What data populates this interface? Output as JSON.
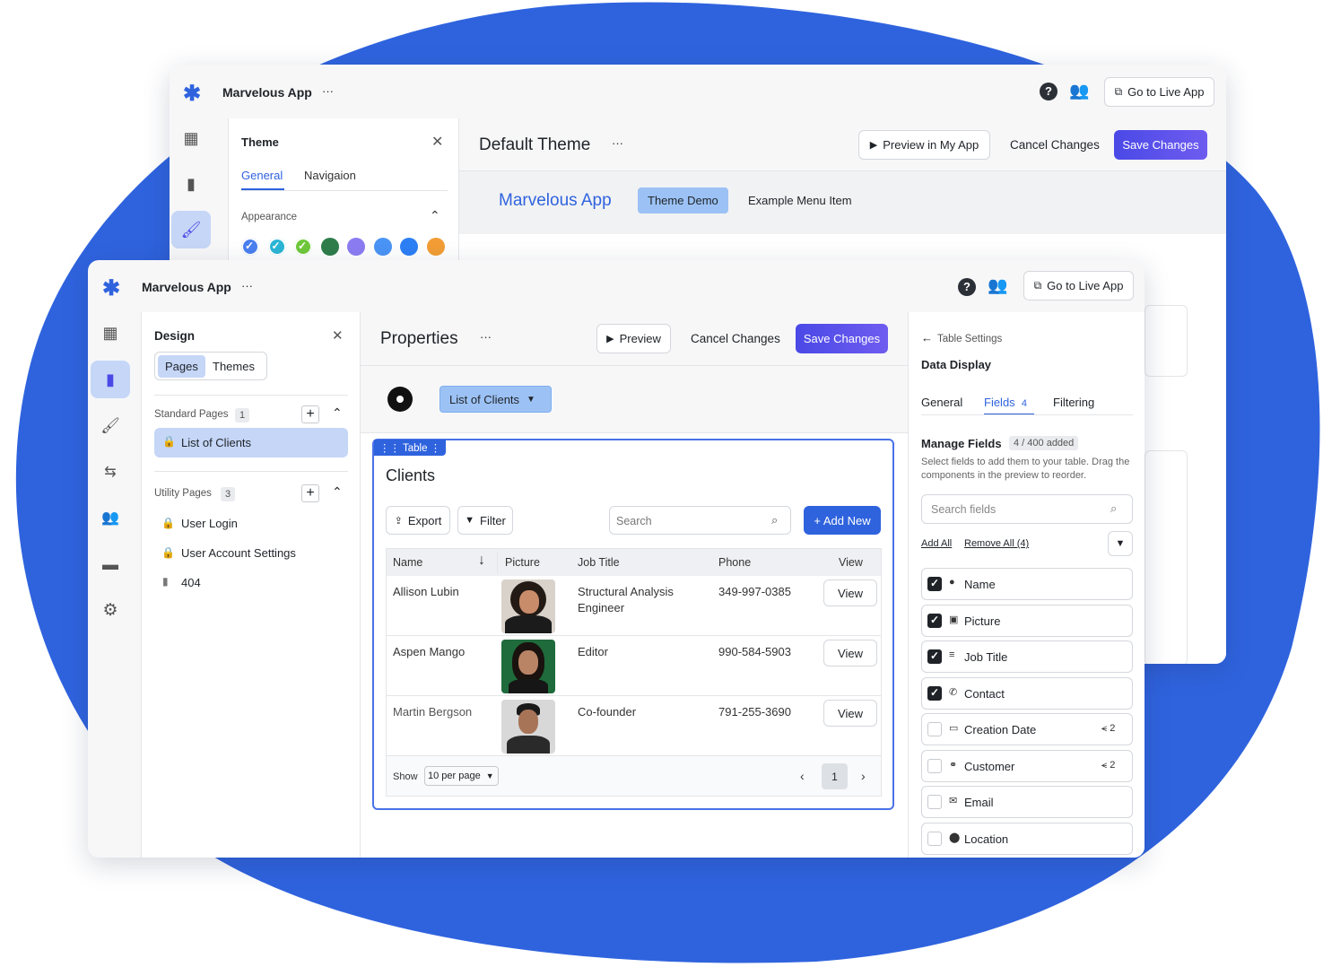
{
  "colors": {
    "accent": "#2f63de",
    "primary": "#5650ea",
    "selected_bg": "#c5d6f7",
    "blob": "#2f63de"
  },
  "back_window": {
    "app_name": "Marvelous App",
    "more": "···",
    "go_live": "Go to Live App",
    "theme_panel": {
      "title": "Theme",
      "tabs": [
        "General",
        "Navigaion"
      ],
      "section": "Appearance"
    },
    "swatches": [
      "#4a7ff0",
      "#2bb5d6",
      "#6ec83a",
      "#2e7d4a",
      "#8b7cf2",
      "#4a94f5",
      "#2d7ff5",
      "#f29d35"
    ],
    "theme_title": "Default Theme",
    "preview_btn": "Preview in My App",
    "cancel": "Cancel Changes",
    "save": "Save Changes",
    "demo": {
      "brand": "Marvelous App",
      "active": "Theme Demo",
      "menu": "Example Menu Item"
    }
  },
  "front_window": {
    "app_name": "Marvelous App",
    "more": "···",
    "go_live": "Go to Live App",
    "design_panel": {
      "title": "Design",
      "tabs": [
        "Pages",
        "Themes"
      ],
      "standard": {
        "label": "Standard Pages",
        "count": "1",
        "items": [
          "List of Clients"
        ]
      },
      "utility": {
        "label": "Utility Pages",
        "count": "3",
        "items": [
          "User Login",
          "User Account Settings",
          "404"
        ]
      }
    },
    "properties": {
      "title": "Properties",
      "more": "···",
      "preview": "Preview",
      "cancel": "Cancel Changes",
      "save": "Save Changes",
      "page_select": "List of Clients"
    },
    "table_block": {
      "tag": "Table",
      "title": "Clients",
      "export": "Export",
      "filter": "Filter",
      "search_placeholder": "Search",
      "add_new": "+ Add New",
      "columns": [
        "Name",
        "Picture",
        "Job Title",
        "Phone",
        "View"
      ],
      "rows": [
        {
          "name": "Allison Lubin",
          "job": "Structural Analysis Engineer",
          "phone": "349-997-0385",
          "view": "View"
        },
        {
          "name": "Aspen Mango",
          "job": "Editor",
          "phone": "990-584-5903",
          "view": "View"
        },
        {
          "name": "Martin Bergson",
          "job": "Co-founder",
          "phone": "791-255-3690",
          "view": "View"
        }
      ],
      "show_label": "Show",
      "per_page": "10 per page",
      "page": "1"
    },
    "settings": {
      "back": "Table Settings",
      "title": "Data Display",
      "tabs": [
        "General",
        "Fields",
        "Filtering"
      ],
      "fields_count": "4",
      "manage_title": "Manage Fields",
      "manage_count": "4 / 400 added",
      "manage_desc": "Select fields to add them to your table. Drag the components in the preview to reorder.",
      "search_placeholder": "Search fields",
      "add_all": "Add All",
      "remove_all": "Remove All (4)",
      "fields": [
        {
          "label": "Name",
          "checked": true,
          "icon": "person-icon"
        },
        {
          "label": "Picture",
          "checked": true,
          "icon": "image-icon"
        },
        {
          "label": "Job Title",
          "checked": true,
          "icon": "text-icon"
        },
        {
          "label": "Contact",
          "checked": true,
          "icon": "phone-icon"
        },
        {
          "label": "Creation Date",
          "checked": false,
          "icon": "calendar-icon",
          "badge": "2"
        },
        {
          "label": "Customer",
          "checked": false,
          "icon": "link-icon",
          "badge": "2"
        },
        {
          "label": "Email",
          "checked": false,
          "icon": "mail-icon"
        },
        {
          "label": "Location",
          "checked": false,
          "icon": "pin-icon"
        }
      ]
    }
  }
}
